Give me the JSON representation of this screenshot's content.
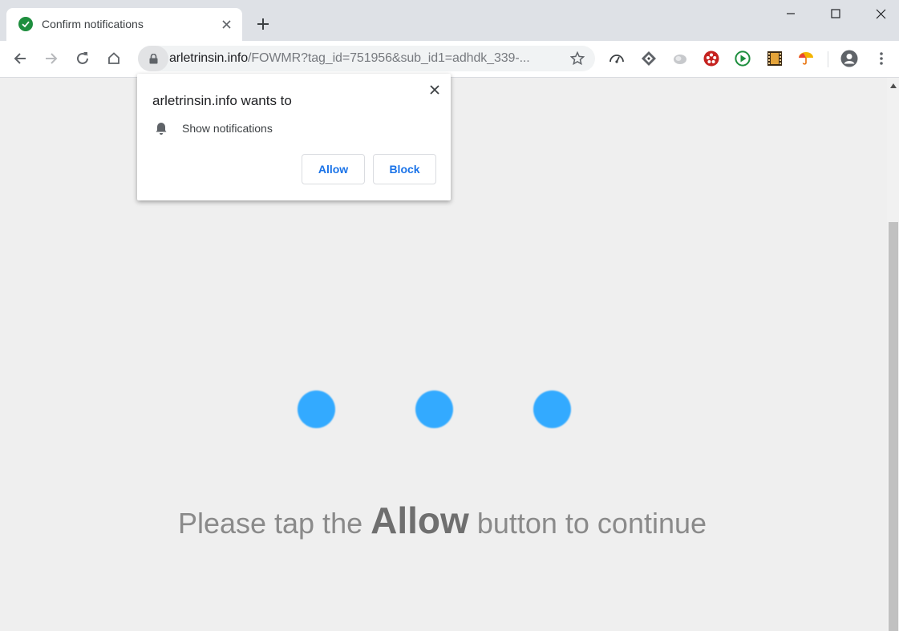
{
  "tab": {
    "title": "Confirm notifications",
    "favicon": "check-circle-icon"
  },
  "window_controls": [
    "minimize-icon",
    "maximize-icon",
    "close-icon"
  ],
  "toolbar": {
    "url_host": "arletrinsin.info",
    "url_path": "/FOWMR?tag_id=751956&sub_id1=adhdk_339-...",
    "extensions": [
      "speed-icon",
      "diamond-extension-icon",
      "cloud-extension-icon",
      "film-reel-extension-icon",
      "play-extension-icon",
      "film-strip-extension-icon",
      "umbrella-extension-icon"
    ]
  },
  "popup": {
    "title": "arletrinsin.info wants to",
    "permission": "Show notifications",
    "allow_label": "Allow",
    "block_label": "Block"
  },
  "page": {
    "message_before": "Please tap the",
    "message_strong": "Allow",
    "message_after": "button to continue",
    "dot_color": "#33aaff"
  },
  "colors": {
    "accent": "#1a73e8",
    "page_bg": "#efefef"
  }
}
